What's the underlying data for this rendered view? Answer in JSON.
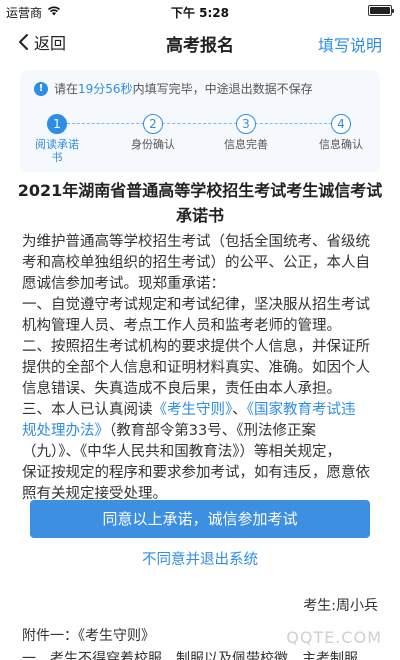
{
  "status_bar": {
    "carrier": "运营商",
    "time": "下午 5:28"
  },
  "nav": {
    "back_label": "返回",
    "title": "高考报名",
    "action_label": "填写说明"
  },
  "timer": {
    "prefix": "请在",
    "remaining": "19分56秒",
    "suffix": "内填写完毕，中途退出数据不保存"
  },
  "steps": [
    {
      "number": "1",
      "label_line1": "阅读承诺",
      "label_line2": "书",
      "active": true
    },
    {
      "number": "2",
      "label_line1": "身份确认",
      "label_line2": "",
      "active": false
    },
    {
      "number": "3",
      "label_line1": "信息完善",
      "label_line2": "",
      "active": false
    },
    {
      "number": "4",
      "label_line1": "信息确认",
      "label_line2": "",
      "active": false
    }
  ],
  "document": {
    "title_line1": "2021年湖南省普通高等学校招生考试考生诚信考试",
    "title_line2": "承诺书",
    "para1_line1": "为维护普通高等学校招生考试（包括全国统考、省级统",
    "para1_line2": "考和高校单独组织的招生考试）的公平、公正，本人自",
    "para1_line3": "愿诚信参加考试。现郑重承诺：",
    "item1_line1": "一、自觉遵守考试规定和考试纪律，坚决服从招生考试",
    "item1_line2": "机构管理人员、考点工作人员和监考老师的管理。",
    "item2_line1": "二、按照招生考试机构的要求提供个人信息，并保证所",
    "item2_line2": "提供的全部个人信息和证明材料真实、准确。如因个人",
    "item2_line3": "信息错误、失真造成不良后果，责任由本人承担。",
    "item3_prefix": "三、本人已认真阅读",
    "item3_link1": "《考生守则》",
    "item3_sep": "、",
    "item3_link2_a": "《国家教育考试违",
    "item3_link2_b": "规处理办法》",
    "item3_after_link": "（教育部令第33号、《刑法修正案",
    "item3_line3": "（九）》、《中华人民共和国教育法》）等相关规定，",
    "item3_line4": "保证按规定的程序和要求参加考试，如有违反，愿意依",
    "item3_line5": "照有关规定接受处理。"
  },
  "buttons": {
    "agree": "同意以上承诺，诚信参加考试",
    "disagree": "不同意并退出系统"
  },
  "signature": "考生:周小兵",
  "attachment_label": "附件一：《考生守则》",
  "attachment_line2": "一、考生不得穿着校服、制服以及佩带校徽、主考制服",
  "watermark": "QQTE.COM"
}
